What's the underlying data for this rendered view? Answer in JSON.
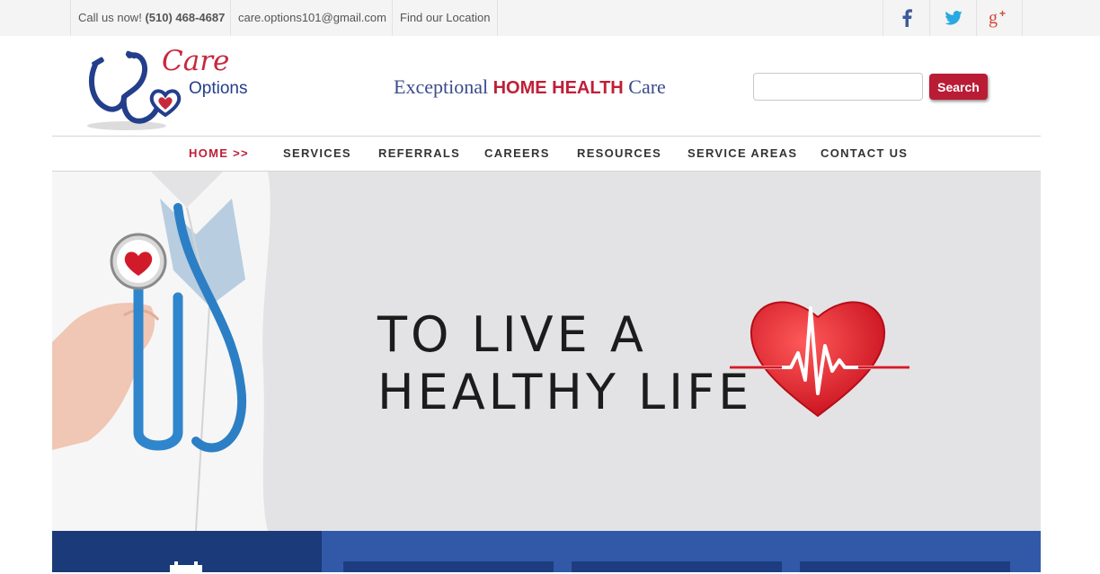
{
  "topbar": {
    "call_label": "Call us now!",
    "phone": "(510) 468-4687",
    "email": "care.options101@gmail.com",
    "location_link": "Find our Location"
  },
  "social": [
    "facebook-icon",
    "twitter-icon",
    "google-plus-icon"
  ],
  "logo": {
    "word1": "Care",
    "word2": "Options"
  },
  "tagline": {
    "part1": "Exceptional ",
    "highlight": "HOME HEALTH",
    "part2": " Care"
  },
  "search": {
    "placeholder": "",
    "button_label": "Search"
  },
  "nav": {
    "items": [
      {
        "label": "HOME >>"
      },
      {
        "label": "SERVICES"
      },
      {
        "label": "REFERRALS"
      },
      {
        "label": "CAREERS"
      },
      {
        "label": "RESOURCES"
      },
      {
        "label": "SERVICE AREAS"
      },
      {
        "label": "CONTACT US"
      }
    ]
  },
  "hero": {
    "line1": "TO LIVE A",
    "line2": "HEALTHY LIFE"
  },
  "colors": {
    "brand_red": "#c01e37",
    "brand_blue": "#233e8b",
    "panel_blue": "#3259a8",
    "panel_dark": "#1b3a7a"
  }
}
